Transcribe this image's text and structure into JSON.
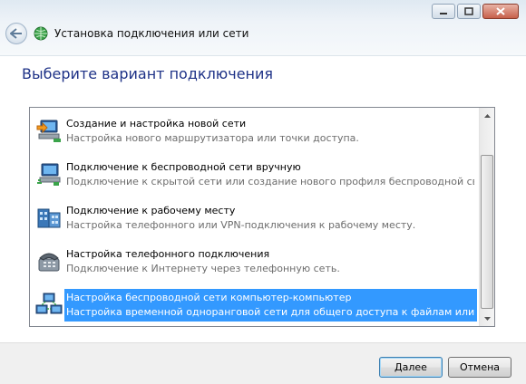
{
  "window": {
    "title": "Установка подключения или сети",
    "heading": "Выберите вариант подключения"
  },
  "options": [
    {
      "title": "Создание и настройка новой сети",
      "description": "Настройка нового маршрутизатора или точки доступа.",
      "icon": "network-setup-icon",
      "selected": false
    },
    {
      "title": "Подключение к беспроводной сети вручную",
      "description": "Подключение к скрытой сети или создание нового профиля беспроводной связи.",
      "icon": "wireless-manual-icon",
      "selected": false
    },
    {
      "title": "Подключение к рабочему месту",
      "description": "Настройка телефонного или VPN-подключения к рабочему месту.",
      "icon": "workplace-icon",
      "selected": false
    },
    {
      "title": "Настройка телефонного подключения",
      "description": "Подключение к Интернету через телефонную сеть.",
      "icon": "telephone-icon",
      "selected": false
    },
    {
      "title": "Настройка беспроводной сети компьютер-компьютер",
      "description": "Настройка временной одноранговой сети для общего доступа к файлам или к Инт...",
      "icon": "adhoc-network-icon",
      "selected": true
    }
  ],
  "buttons": {
    "next": "Далее",
    "cancel": "Отмена"
  },
  "colors": {
    "heading": "#1e3287",
    "selection": "#3399ff"
  }
}
